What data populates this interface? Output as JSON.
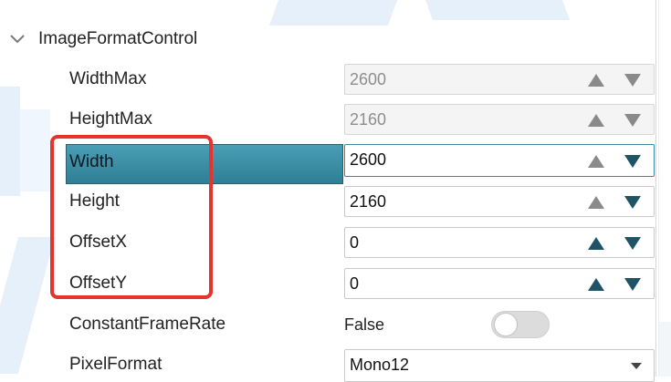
{
  "group": {
    "title": "ImageFormatControl",
    "expanded": true
  },
  "colors": {
    "selected_row": "#3b8ca4",
    "arrow_active": "#1f5466",
    "arrow_disabled": "#8a8a8a",
    "highlight": "#e5342e"
  },
  "rows": [
    {
      "label": "WidthMax",
      "value": "2600",
      "disabled": true,
      "up_enabled": false,
      "down_enabled": false
    },
    {
      "label": "HeightMax",
      "value": "2160",
      "disabled": true,
      "up_enabled": false,
      "down_enabled": false
    },
    {
      "label": "Width",
      "value": "2600",
      "selected": true,
      "up_enabled": false,
      "down_enabled": true
    },
    {
      "label": "Height",
      "value": "2160",
      "up_enabled": false,
      "down_enabled": true
    },
    {
      "label": "OffsetX",
      "value": "0",
      "up_enabled": true,
      "down_enabled": true
    },
    {
      "label": "OffsetY",
      "value": "0",
      "up_enabled": true,
      "down_enabled": true
    },
    {
      "label": "ConstantFrameRate",
      "value": "False",
      "toggle_on": false
    },
    {
      "label": "PixelFormat",
      "value": "Mono12"
    }
  ],
  "icons": {
    "group_toggle": "chevron-down-icon",
    "increment": "triangle-up-icon",
    "decrement": "triangle-down-icon",
    "dropdown": "caret-down-icon"
  }
}
